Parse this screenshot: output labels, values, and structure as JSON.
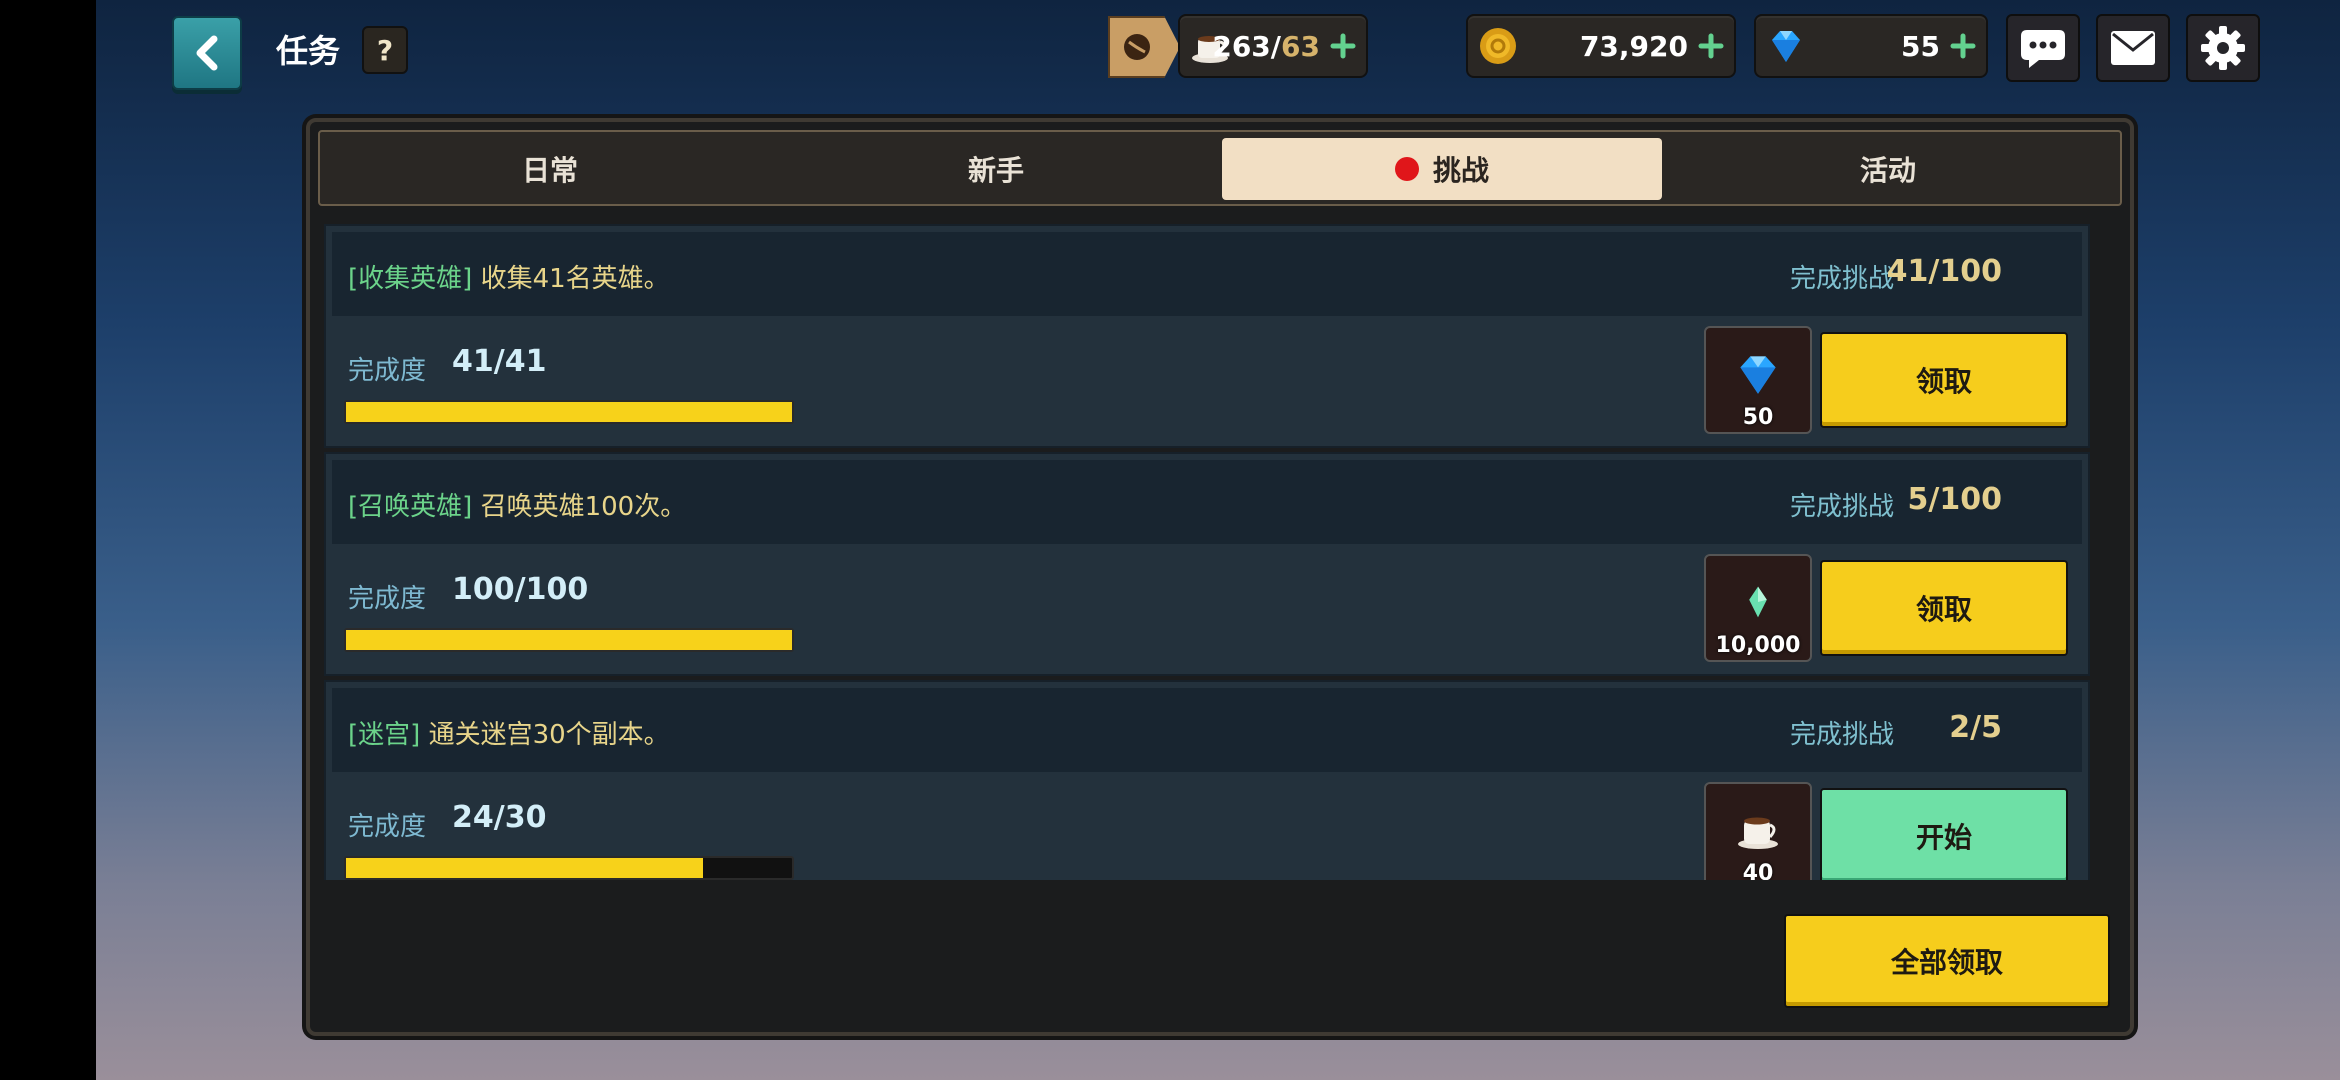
{
  "header": {
    "title": "任务",
    "help_label": "?"
  },
  "resources": {
    "stamina": {
      "value": "263/",
      "max": "63"
    },
    "gold": {
      "value": "73,920"
    },
    "gems": {
      "value": "55"
    }
  },
  "tabs": [
    {
      "label": "日常",
      "active": false
    },
    {
      "label": "新手",
      "active": false
    },
    {
      "label": "挑战",
      "active": true
    },
    {
      "label": "活动",
      "active": false
    }
  ],
  "quests": [
    {
      "tag": "[收集英雄]",
      "text": "收集41名英雄。",
      "challenge_label": "完成挑战",
      "challenge_value": "41/100",
      "progress_label": "完成度",
      "progress_value": "41/41",
      "progress_fraction": 1.0,
      "reward_icon": "gem-icon",
      "reward_amount": "50",
      "action_label": "领取",
      "action_color": "#f6cd1c"
    },
    {
      "tag": "[召唤英雄]",
      "text": "召唤英雄100次。",
      "challenge_label": "完成挑战",
      "challenge_value": "5/100",
      "progress_label": "完成度",
      "progress_value": "100/100",
      "progress_fraction": 1.0,
      "reward_icon": "crystal-icon",
      "reward_amount": "10,000",
      "action_label": "领取",
      "action_color": "#f6cd1c"
    },
    {
      "tag": "[迷宫]",
      "text": "通关迷宫30个副本。",
      "challenge_label": "完成挑战",
      "challenge_value": "2/5",
      "progress_label": "完成度",
      "progress_value": "24/30",
      "progress_fraction": 0.8,
      "reward_icon": "coffee-cup-icon",
      "reward_amount": "40",
      "action_label": "开始",
      "action_color": "#6ee0a6"
    }
  ],
  "footer": {
    "claim_all_label": "全部领取"
  }
}
